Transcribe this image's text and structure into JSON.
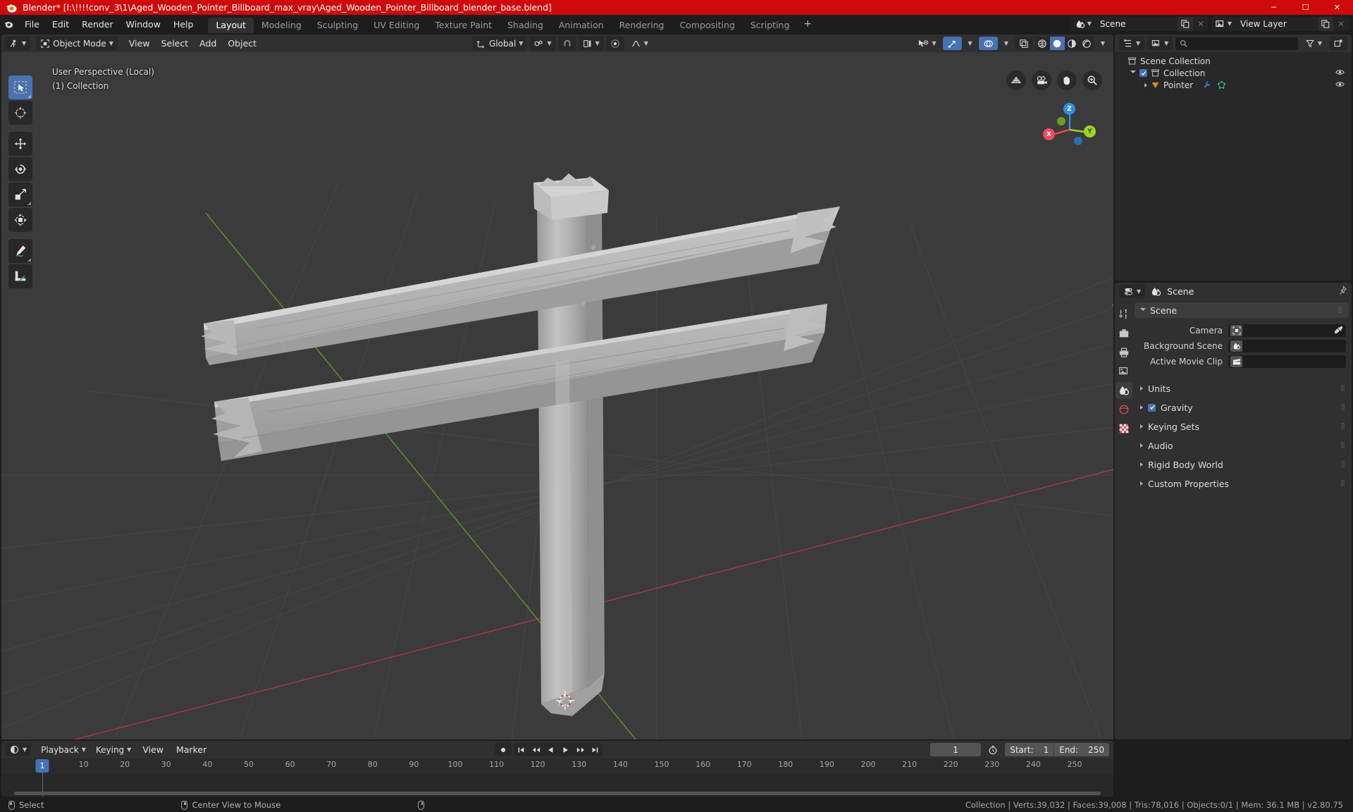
{
  "window": {
    "title": "Blender* [I:\\!!!!conv_3\\1\\Aged_Wooden_Pointer_Billboard_max_vray\\Aged_Wooden_Pointer_Billboard_blender_base.blend]",
    "minimize": "─",
    "maximize": "☐",
    "close": "✕"
  },
  "topbar": {
    "menus": [
      "File",
      "Edit",
      "Render",
      "Window",
      "Help"
    ],
    "tabs": [
      {
        "label": "Layout",
        "active": true
      },
      {
        "label": "Modeling",
        "active": false
      },
      {
        "label": "Sculpting",
        "active": false
      },
      {
        "label": "UV Editing",
        "active": false
      },
      {
        "label": "Texture Paint",
        "active": false
      },
      {
        "label": "Shading",
        "active": false
      },
      {
        "label": "Animation",
        "active": false
      },
      {
        "label": "Rendering",
        "active": false
      },
      {
        "label": "Compositing",
        "active": false
      },
      {
        "label": "Scripting",
        "active": false
      }
    ],
    "add_tab_label": "+",
    "scene": {
      "name": "Scene",
      "new_label": "",
      "remove_label": "✕"
    },
    "view_layer": {
      "name": "View Layer",
      "new_label": "",
      "remove_label": "✕"
    }
  },
  "viewport": {
    "mode": "Object Mode",
    "menus": [
      "View",
      "Select",
      "Add",
      "Object"
    ],
    "transform_orientation": "Global",
    "overlay_line1": "User Perspective (Local)",
    "overlay_line2": "(1) Collection",
    "gizmo_axes": [
      {
        "label": "X",
        "color": "#ec4a5b"
      },
      {
        "label": "Y",
        "color": "#9dd527"
      },
      {
        "label": "Z",
        "color": "#2e8fdd"
      }
    ],
    "nav_icons": [
      "grid-icon",
      "camera-icon",
      "hand-icon",
      "zoom-icon"
    ],
    "tools": [
      "select-box-tool",
      "cursor-tool",
      "move-tool",
      "rotate-tool",
      "scale-tool",
      "transform-tool",
      "annotate-tool",
      "measure-tool"
    ]
  },
  "outliner": {
    "search_placeholder": "",
    "rows": [
      {
        "label": "Scene Collection",
        "indent": 0,
        "icon": "collection-icon",
        "expand": "none",
        "checkbox": false,
        "eye": false
      },
      {
        "label": "Collection",
        "indent": 1,
        "icon": "collection-icon",
        "expand": "down",
        "checkbox": true,
        "eye": true
      },
      {
        "label": "Pointer",
        "indent": 2,
        "icon": "mesh-object-icon",
        "expand": "right",
        "checkbox": false,
        "eye": true
      }
    ]
  },
  "properties": {
    "title": "Scene",
    "panel_title": "Scene",
    "fields": [
      {
        "label": "Camera",
        "icon": "camera-data-icon",
        "value": "",
        "eyedropper": true
      },
      {
        "label": "Background Scene",
        "icon": "scene-icon",
        "value": "",
        "eyedropper": false
      },
      {
        "label": "Active Movie Clip",
        "icon": "clip-icon",
        "value": "",
        "eyedropper": false
      }
    ],
    "sections": [
      {
        "label": "Units",
        "checkbox": null
      },
      {
        "label": "Gravity",
        "checkbox": true
      },
      {
        "label": "Keying Sets",
        "checkbox": null
      },
      {
        "label": "Audio",
        "checkbox": null
      },
      {
        "label": "Rigid Body World",
        "checkbox": null
      },
      {
        "label": "Custom Properties",
        "checkbox": null
      }
    ],
    "tabs": [
      {
        "name": "tool-tab",
        "active": false
      },
      {
        "name": "render-tab",
        "active": false
      },
      {
        "name": "output-tab",
        "active": false
      },
      {
        "name": "view-layer-tab",
        "active": false
      },
      {
        "name": "scene-tab",
        "active": true
      },
      {
        "name": "world-tab",
        "active": false
      },
      {
        "name": "texture-tab",
        "active": false
      }
    ]
  },
  "timeline": {
    "menus": [
      "Playback",
      "Keying",
      "View",
      "Marker"
    ],
    "current_frame": "1",
    "start_label": "Start:",
    "start_value": "1",
    "end_label": "End:",
    "end_value": "250",
    "ticks": [
      10,
      20,
      30,
      40,
      50,
      60,
      70,
      80,
      90,
      100,
      110,
      120,
      130,
      140,
      150,
      160,
      170,
      180,
      190,
      200,
      210,
      220,
      230,
      240,
      250
    ],
    "playhead_label": "1"
  },
  "statusbar": {
    "left_items": [
      {
        "mouse": "left",
        "label": "Select"
      },
      {
        "mouse": "mid",
        "label": "Center View to Mouse"
      },
      {
        "mouse": "right",
        "label": ""
      }
    ],
    "stats": "Collection | Verts:39,032 | Faces:39,008 | Tris:78,016 | Objects:0/1 | Mem: 36.1 MB | v2.80.75"
  },
  "colors": {
    "title_bar": "#cf0a0a",
    "accent_blue": "#4772b3",
    "viewport_bg": "#3b3b3b",
    "panel_bg": "#303030",
    "axis_x": "#ec4a5b",
    "axis_y": "#9dd527",
    "axis_z": "#2e8fdd"
  }
}
